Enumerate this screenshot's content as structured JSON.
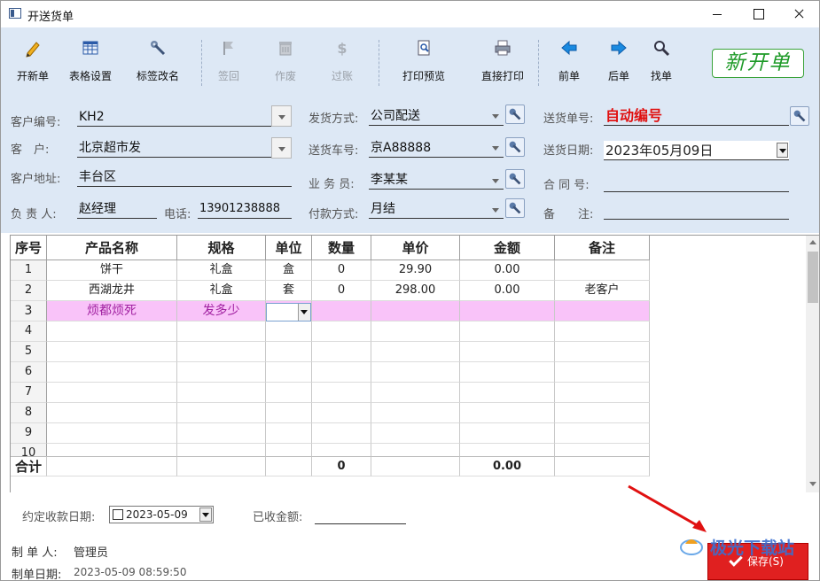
{
  "window": {
    "title": "开送货单"
  },
  "toolbar": {
    "buttons": [
      {
        "label": "开新单",
        "icon": "pencil-icon"
      },
      {
        "label": "表格设置",
        "icon": "table-grid-icon"
      },
      {
        "label": "标签改名",
        "icon": "wrench-icon"
      },
      {
        "label": "签回",
        "icon": "flag-icon"
      },
      {
        "label": "作废",
        "icon": "trash-icon"
      },
      {
        "label": "过账",
        "icon": "dollar-icon"
      },
      {
        "label": "打印预览",
        "icon": "print-preview-icon"
      },
      {
        "label": "直接打印",
        "icon": "printer-icon"
      },
      {
        "label": "前单",
        "icon": "arrow-left-icon"
      },
      {
        "label": "后单",
        "icon": "arrow-right-icon"
      },
      {
        "label": "找单",
        "icon": "magnifier-icon"
      }
    ],
    "new_bill_badge": "新开单"
  },
  "form": {
    "customer_code_label": "客户编号:",
    "customer_code": "KH2",
    "customer_label": "客　户:",
    "customer": "北京超市发",
    "address_label": "客户地址:",
    "address": "丰台区",
    "person_label": "负 责 人:",
    "person": "赵经理",
    "phone_label": "电话:",
    "phone": "13901238888",
    "ship_method_label": "发货方式:",
    "ship_method": "公司配送",
    "truck_label": "送货车号:",
    "truck": "京A88888",
    "sales_label": "业 务 员:",
    "sales": "李某某",
    "payment_label": "付款方式:",
    "payment": "月结",
    "bill_no_label": "送货单号:",
    "bill_no": "自动编号",
    "ship_date_label": "送货日期:",
    "ship_date": "2023年05月09日",
    "contract_label": "合 同 号:",
    "contract": "",
    "remark_label": "备　　注:",
    "remark": ""
  },
  "grid": {
    "headers": [
      "序号",
      "产品名称",
      "规格",
      "单位",
      "数量",
      "单价",
      "金额",
      "备注"
    ],
    "rows": [
      {
        "no": "1",
        "name": "饼干",
        "spec": "礼盒",
        "unit": "盒",
        "qty": "0",
        "price": "29.90",
        "amount": "0.00",
        "note": ""
      },
      {
        "no": "2",
        "name": "西湖龙井",
        "spec": "礼盒",
        "unit": "套",
        "qty": "0",
        "price": "298.00",
        "amount": "0.00",
        "note": "老客户"
      },
      {
        "no": "3",
        "name": "烦都烦死",
        "spec": "发多少",
        "unit": "",
        "qty": "",
        "price": "",
        "amount": "",
        "note": ""
      },
      {
        "no": "4",
        "name": "",
        "spec": "",
        "unit": "",
        "qty": "",
        "price": "",
        "amount": "",
        "note": ""
      },
      {
        "no": "5",
        "name": "",
        "spec": "",
        "unit": "",
        "qty": "",
        "price": "",
        "amount": "",
        "note": ""
      },
      {
        "no": "6",
        "name": "",
        "spec": "",
        "unit": "",
        "qty": "",
        "price": "",
        "amount": "",
        "note": ""
      },
      {
        "no": "7",
        "name": "",
        "spec": "",
        "unit": "",
        "qty": "",
        "price": "",
        "amount": "",
        "note": ""
      },
      {
        "no": "8",
        "name": "",
        "spec": "",
        "unit": "",
        "qty": "",
        "price": "",
        "amount": "",
        "note": ""
      },
      {
        "no": "9",
        "name": "",
        "spec": "",
        "unit": "",
        "qty": "",
        "price": "",
        "amount": "",
        "note": ""
      },
      {
        "no": "10",
        "name": "",
        "spec": "",
        "unit": "",
        "qty": "",
        "price": "",
        "amount": "",
        "note": ""
      }
    ],
    "total": {
      "label": "合计",
      "qty": "0",
      "amount": "0.00"
    }
  },
  "footer": {
    "pay_date_label": "约定收款日期:",
    "pay_date": "2023-05-09",
    "paid_label": "已收金额:",
    "paid": "",
    "maker_label": "制 单 人:",
    "maker": "管理员",
    "make_date_label": "制单日期:",
    "make_date": "2023-05-09 08:59:50",
    "save_label": "保存(S)",
    "watermark": "极光下载站"
  },
  "colors": {
    "toolbar_bg": "#dde8f5",
    "active_row": "#f9c3f9",
    "save_bg": "#e02020",
    "bill_no_red": "#e01010",
    "badge_green": "#1e9a28"
  }
}
